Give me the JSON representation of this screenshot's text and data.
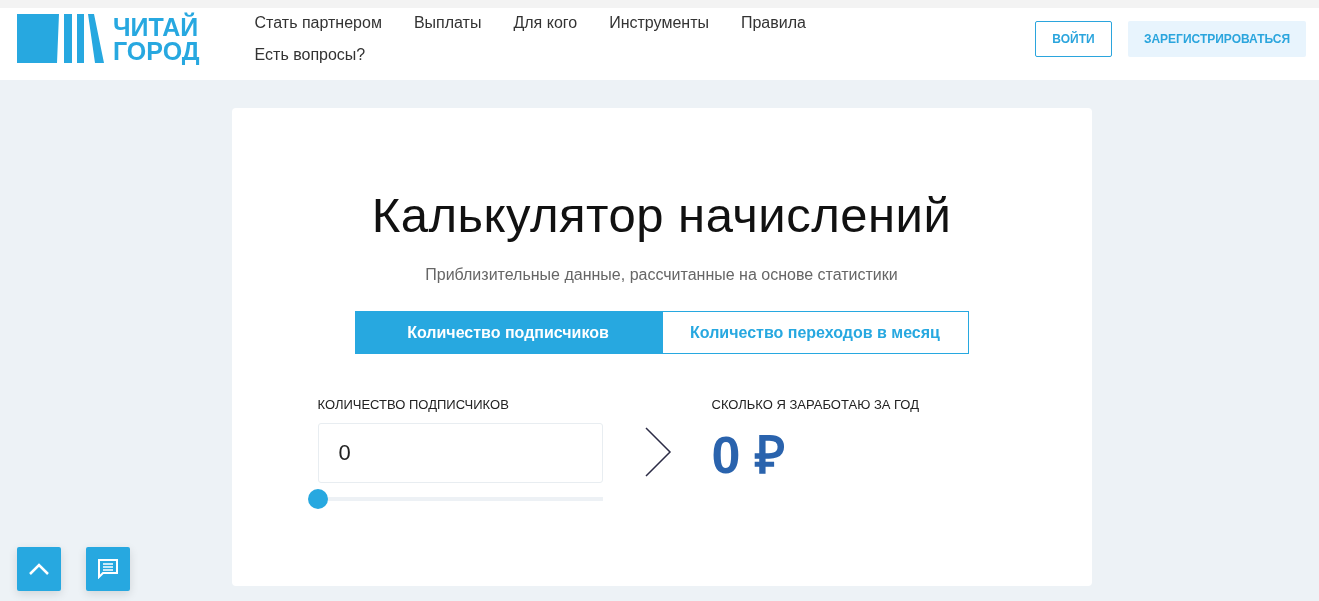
{
  "header": {
    "logo": [
      "ЧИТАЙ",
      "ГОРОД"
    ],
    "nav": [
      {
        "label": "Стать партнером"
      },
      {
        "label": "Выплаты"
      },
      {
        "label": "Для кого"
      },
      {
        "label": "Инструменты"
      },
      {
        "label": "Правила"
      },
      {
        "label": "Есть вопросы?"
      }
    ],
    "login_button": "ВОЙТИ",
    "register_button": "ЗАРЕГИСТРИРОВАТЬСЯ"
  },
  "calculator": {
    "title": "Калькулятор начислений",
    "subtitle": "Приблизительные данные, рассчитанные на основе статистики",
    "tabs": [
      {
        "label": "Количество подписчиков",
        "selected": true
      },
      {
        "label": "Количество переходов в месяц",
        "selected": false
      }
    ],
    "input_label": "КОЛИЧЕСТВО ПОДПИСЧИКОВ",
    "input_value": "0",
    "slider": {
      "level": 0
    },
    "result_label": "СКОЛЬКО Я ЗАРАБОТАЮ ЗА ГОД",
    "result_value": "0 ₽"
  }
}
